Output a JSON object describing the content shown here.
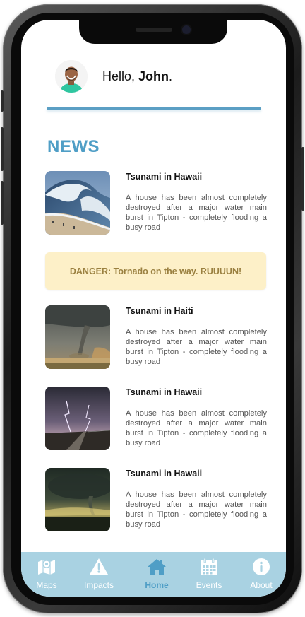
{
  "header": {
    "greeting_prefix": "Hello, ",
    "user_name": "John",
    "greeting_suffix": "."
  },
  "news": {
    "title": "NEWS",
    "items": [
      {
        "title": "Tsunami in Hawaii",
        "description": "A house has been almost completely destroyed after a major water main burst in Tipton - completely flooding a busy road"
      },
      {
        "title": "Tsunami in Haiti",
        "description": "A house has been almost completely destroyed after a major water main burst in Tipton - completely flooding a busy road"
      },
      {
        "title": "Tsunami in Hawaii",
        "description": "A house has been almost completely destroyed after a major water main burst in Tipton - completely flooding a busy road"
      },
      {
        "title": "Tsunami in Hawaii",
        "description": "A house has been almost completely destroyed after a major water main burst in Tipton - completely flooding a busy road"
      }
    ]
  },
  "alert": {
    "text": "DANGER: Tornado on the way. RUUUUN!"
  },
  "tabbar": {
    "tabs": [
      {
        "label": "Maps",
        "icon": "map-icon"
      },
      {
        "label": "Impacts",
        "icon": "warning-icon"
      },
      {
        "label": "Home",
        "icon": "home-icon",
        "active": true
      },
      {
        "label": "Events",
        "icon": "calendar-icon"
      },
      {
        "label": "About",
        "icon": "info-icon"
      }
    ]
  },
  "colors": {
    "accent": "#4f9ec6",
    "tabbar": "#a9d2e2",
    "alert_bg": "#fdf0c8",
    "alert_text": "#9a8040"
  }
}
